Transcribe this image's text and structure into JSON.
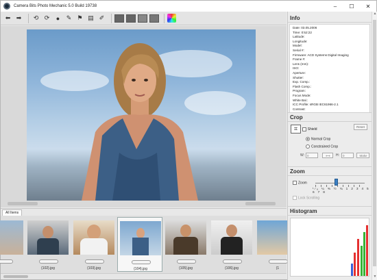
{
  "window": {
    "title": "Camera Bits Photo Mechanic 5.0 Build 19738",
    "minimize": "–",
    "maximize": "☐",
    "close": "✕"
  },
  "toolbar": {
    "back_icon": "arrow-left",
    "forward_icon": "arrow-right"
  },
  "tabs": [
    {
      "label": "All Items"
    }
  ],
  "thumbnails": [
    {
      "label": "",
      "selected": false
    },
    {
      "label": "{102}.jpg",
      "selected": false
    },
    {
      "label": "{103}.jpg",
      "selected": false
    },
    {
      "label": "{104}.jpg",
      "selected": true
    },
    {
      "label": "{105}.jpg",
      "selected": false
    },
    {
      "label": "{106}.jpg",
      "selected": false
    },
    {
      "label": "{1",
      "selected": false
    }
  ],
  "info": {
    "title": "Info",
    "rows": [
      "Date: 03.05.2006",
      "Time: 0:52:22",
      "Latitude:",
      "Longitude:",
      "Model:",
      "Serial #:",
      "Firmware: ACD Systems Digital Imaging",
      "Frame #:",
      "Lens (mm):",
      "ISO:",
      "Aperture:",
      "Shutter:",
      "Exp. Comp.:",
      "Flash Comp.:",
      "Program:",
      "Focus Mode:",
      "White Bal.:",
      "ICC Profile: sRGB IEC61966-2.1",
      "Contrast:"
    ]
  },
  "crop": {
    "title": "Crop",
    "shield_label": "Shield",
    "reset_label": "Reset",
    "normal_crop": "Normal Crop",
    "constrained_crop": "Constrained Crop",
    "w_label": "W:",
    "w_value": "0",
    "h_label": "H:",
    "h_value": "0",
    "make_label": "Make"
  },
  "zoom": {
    "title": "Zoom",
    "zoom_label": "Zoom",
    "lock_scrolling": "Lock Scrolling",
    "levels": "¹⁄₈ ¼ ⅜ ½ ¾ 1 2 3 4 5 6 7 8"
  },
  "histogram": {
    "title": "Histogram"
  },
  "colors": {
    "accent": "#3c7fc3",
    "panel_bg": "#ececec"
  }
}
